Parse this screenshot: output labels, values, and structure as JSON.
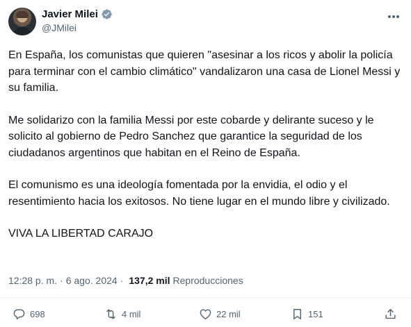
{
  "author": {
    "name": "Javier Milei",
    "handle": "@JMilei"
  },
  "tweet": {
    "paragraphs": [
      "En España, los comunistas que quieren \"asesinar a los ricos y abolir la policía para terminar con el cambio climático\" vandalizaron una casa de Lionel Messi y su familia.",
      "Me solidarizo con la familia Messi por este cobarde y delirante suceso y le solicito al gobierno de Pedro Sanchez que garantice la seguridad de los ciudadanos argentinos que habitan en el Reino de España.",
      "El comunismo es una ideología fomentada por la envidia, el odio y el resentimiento hacia los exitosos. No tiene lugar en el mundo libre y civilizado.",
      "VIVA LA LIBERTAD CARAJO"
    ]
  },
  "meta": {
    "time": "12:28 p. m.",
    "separator": "·",
    "date": "6 ago. 2024",
    "views_count": "137,2 mil",
    "views_label": "Reproducciones"
  },
  "actions": {
    "replies": "698",
    "reposts": "4 mil",
    "likes": "22 mil",
    "bookmarks": "151"
  },
  "colors": {
    "text": "#0f1419",
    "secondary": "#536471",
    "verified": "#829aab",
    "divider": "#eff3f4"
  },
  "icons": [
    "verified-badge-icon",
    "more-options-icon",
    "reply-icon",
    "repost-icon",
    "like-icon",
    "bookmark-icon",
    "share-icon"
  ]
}
